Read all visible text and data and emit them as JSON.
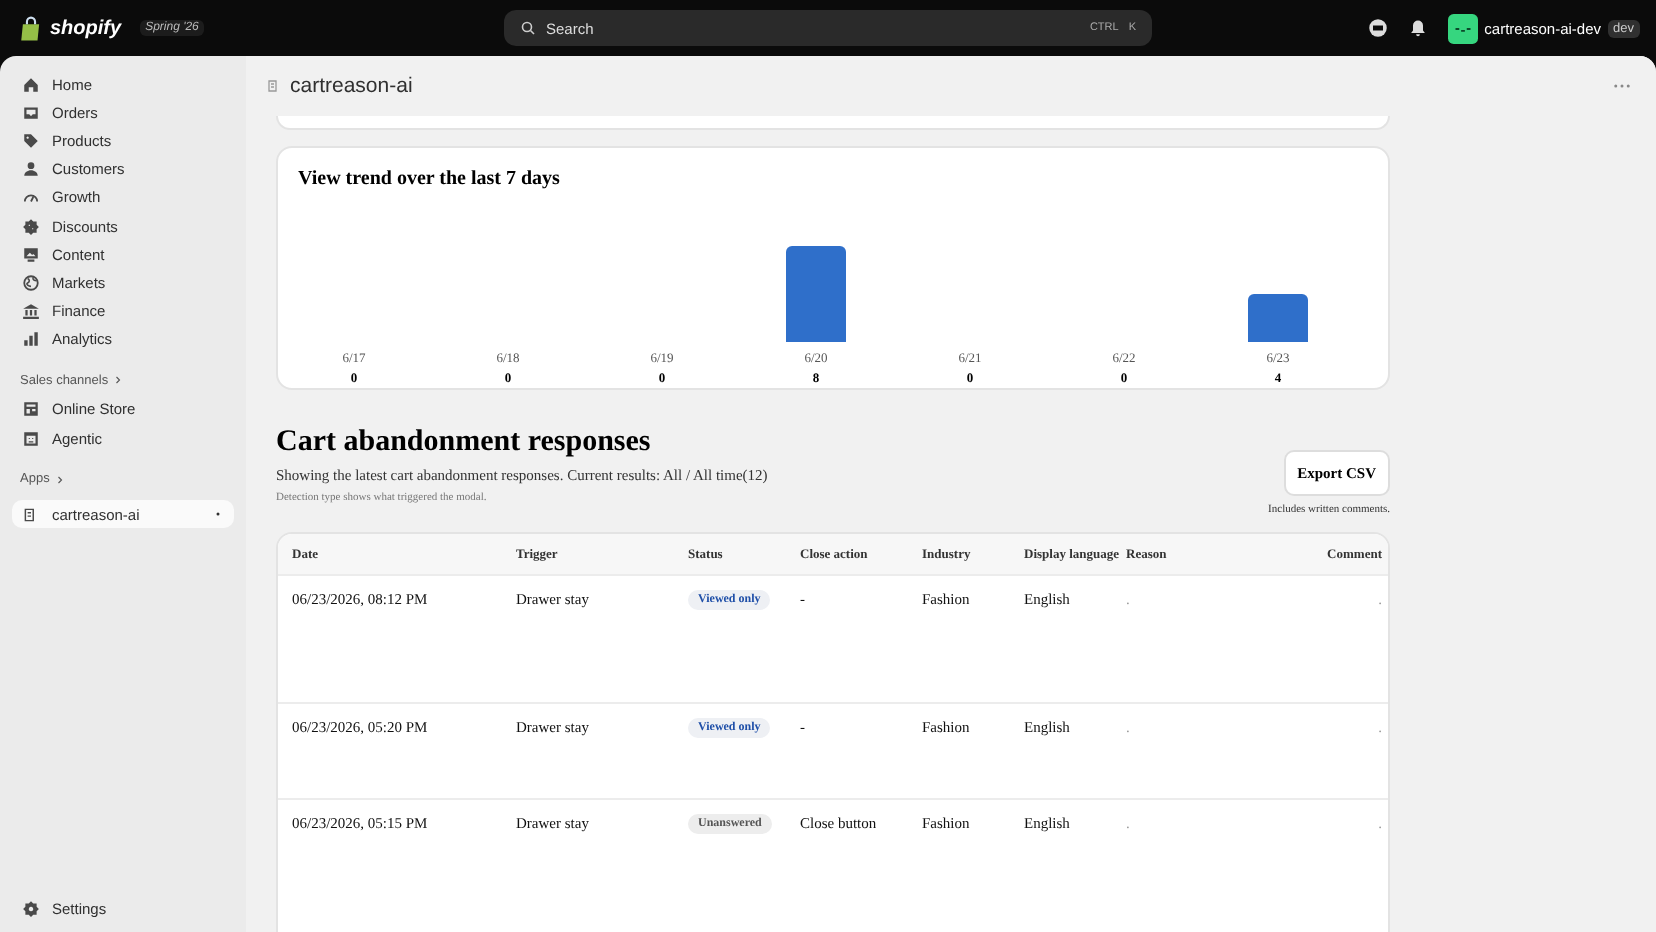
{
  "topbar": {
    "brand": "shopify",
    "release": "Spring '26",
    "search": {
      "placeholder": "Search",
      "shortcut": [
        "CTRL",
        "K"
      ]
    },
    "store": {
      "name": "cartreason-ai-dev",
      "badge": "dev"
    }
  },
  "sidebar": {
    "items": [
      {
        "label": "Home",
        "selected": false
      },
      {
        "label": "Orders",
        "selected": false
      },
      {
        "label": "Products",
        "selected": false
      },
      {
        "label": "Customers",
        "selected": false
      },
      {
        "label": "Growth",
        "selected": false
      },
      {
        "label": "Discounts",
        "selected": false
      },
      {
        "label": "Content",
        "selected": false
      },
      {
        "label": "Markets",
        "selected": false
      },
      {
        "label": "Finance",
        "selected": false
      },
      {
        "label": "Analytics",
        "selected": false
      }
    ],
    "sections": [
      {
        "heading": "Sales channels",
        "items": [
          {
            "label": "Online Store",
            "selected": false
          },
          {
            "label": "Agentic",
            "selected": false
          }
        ]
      },
      {
        "heading": "Apps",
        "items": [
          {
            "label": "cartreason-ai",
            "selected": true
          }
        ]
      }
    ],
    "footer": "Settings"
  },
  "page": {
    "title": "cartreason-ai"
  },
  "trend_card": {
    "title": "View trend over the last 7 days",
    "chart_data": {
      "type": "bar",
      "categories": [
        "6/17",
        "6/18",
        "6/19",
        "6/20",
        "6/21",
        "6/22",
        "6/23"
      ],
      "values": [
        0,
        0,
        0,
        8,
        0,
        0,
        4
      ],
      "data_labels": true
    }
  },
  "responses": {
    "title": "Cart abandonment responses",
    "description": "Showing the latest cart abandonment responses. Current results: All / All time(12)",
    "note": "Detection type shows what triggered the modal.",
    "export_button": "Export CSV",
    "export_note": "Includes written comments.",
    "table": {
      "columns": [
        "Date",
        "Trigger",
        "Status",
        "Close action",
        "Industry",
        "Display language",
        "Reason",
        "Comment"
      ],
      "rows": [
        {
          "date": "06/23/2026, 08:12 PM",
          "trigger": "Drawer stay",
          "status": {
            "label": "Viewed only",
            "kind": "viewed"
          },
          "close_action": "-",
          "industry": "Fashion",
          "language": "English",
          "reason": ".",
          "comment": "."
        },
        {
          "date": "06/23/2026, 05:20 PM",
          "trigger": "Drawer stay",
          "status": {
            "label": "Viewed only",
            "kind": "viewed"
          },
          "close_action": "-",
          "industry": "Fashion",
          "language": "English",
          "reason": ".",
          "comment": "."
        },
        {
          "date": "06/23/2026, 05:15 PM",
          "trigger": "Drawer stay",
          "status": {
            "label": "Unanswered",
            "kind": "unanswered"
          },
          "close_action": "Close button",
          "industry": "Fashion",
          "language": "English",
          "reason": ".",
          "comment": "."
        }
      ]
    }
  }
}
